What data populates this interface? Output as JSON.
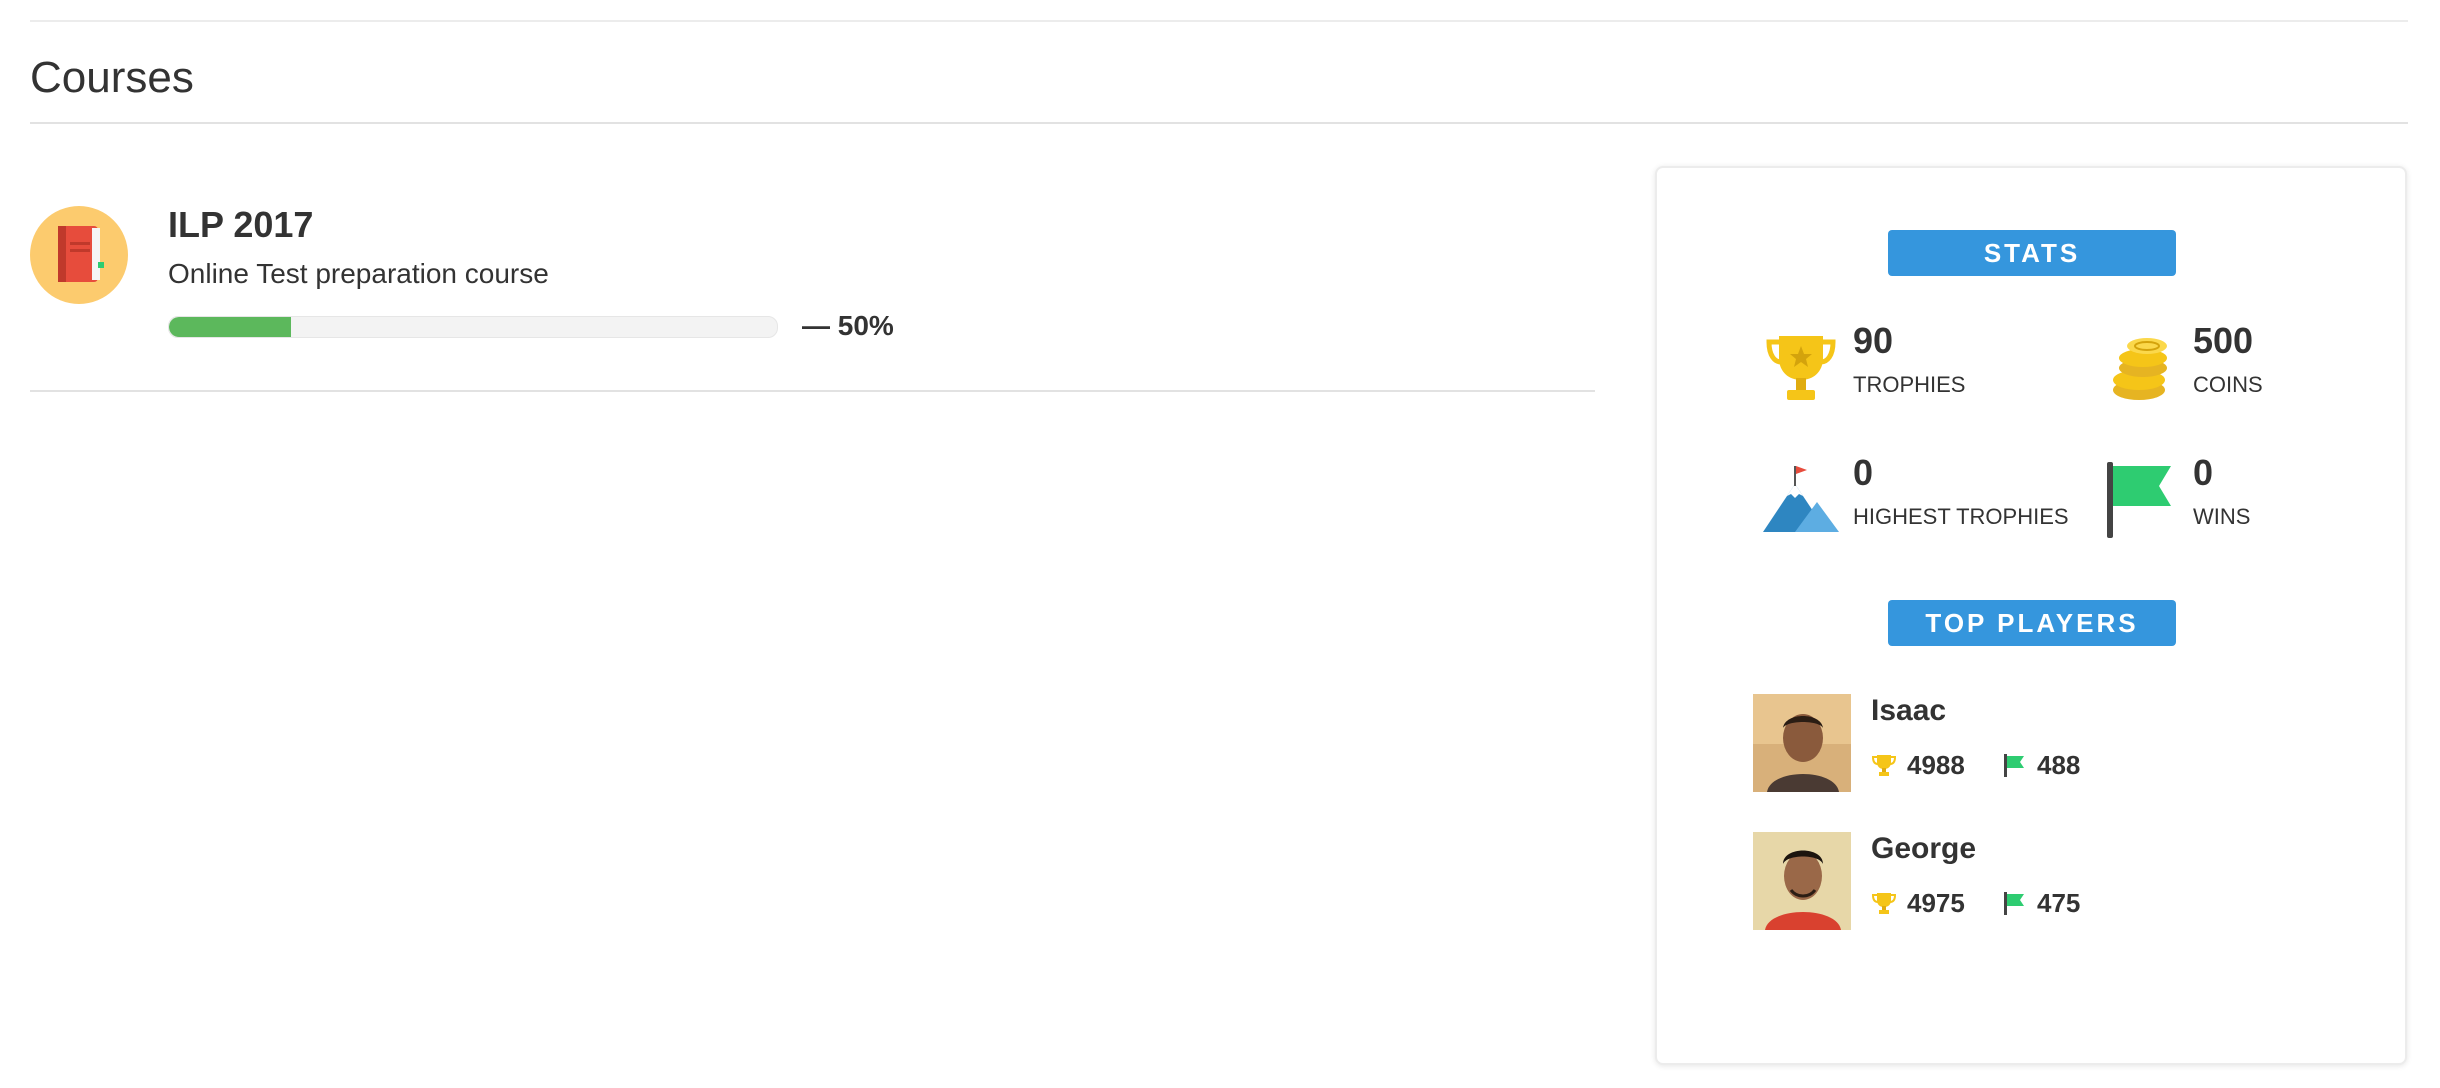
{
  "page": {
    "title": "Courses"
  },
  "course": {
    "name": "ILP 2017",
    "description": "Online Test preparation course",
    "progress_percent": 20,
    "progress_label": "— 50%",
    "icon": "notebook-icon"
  },
  "stats": {
    "heading": "STATS",
    "items": [
      {
        "value": "90",
        "label": "Trophies",
        "icon": "trophy-icon"
      },
      {
        "value": "500",
        "label": "Coins",
        "icon": "coins-icon"
      },
      {
        "value": "0",
        "label": "Highest Trophies",
        "icon": "mountain-icon"
      },
      {
        "value": "0",
        "label": "Wins",
        "icon": "flag-icon"
      }
    ]
  },
  "top_players": {
    "heading": "TOP PLAYERS",
    "players": [
      {
        "name": "Isaac",
        "trophies": "4988",
        "wins": "488"
      },
      {
        "name": "George",
        "trophies": "4975",
        "wins": "475"
      }
    ]
  },
  "colors": {
    "accent_blue": "#3596dd",
    "progress_green": "#5cb85c",
    "trophy_gold": "#f5c518",
    "flag_green": "#2ecc71"
  }
}
